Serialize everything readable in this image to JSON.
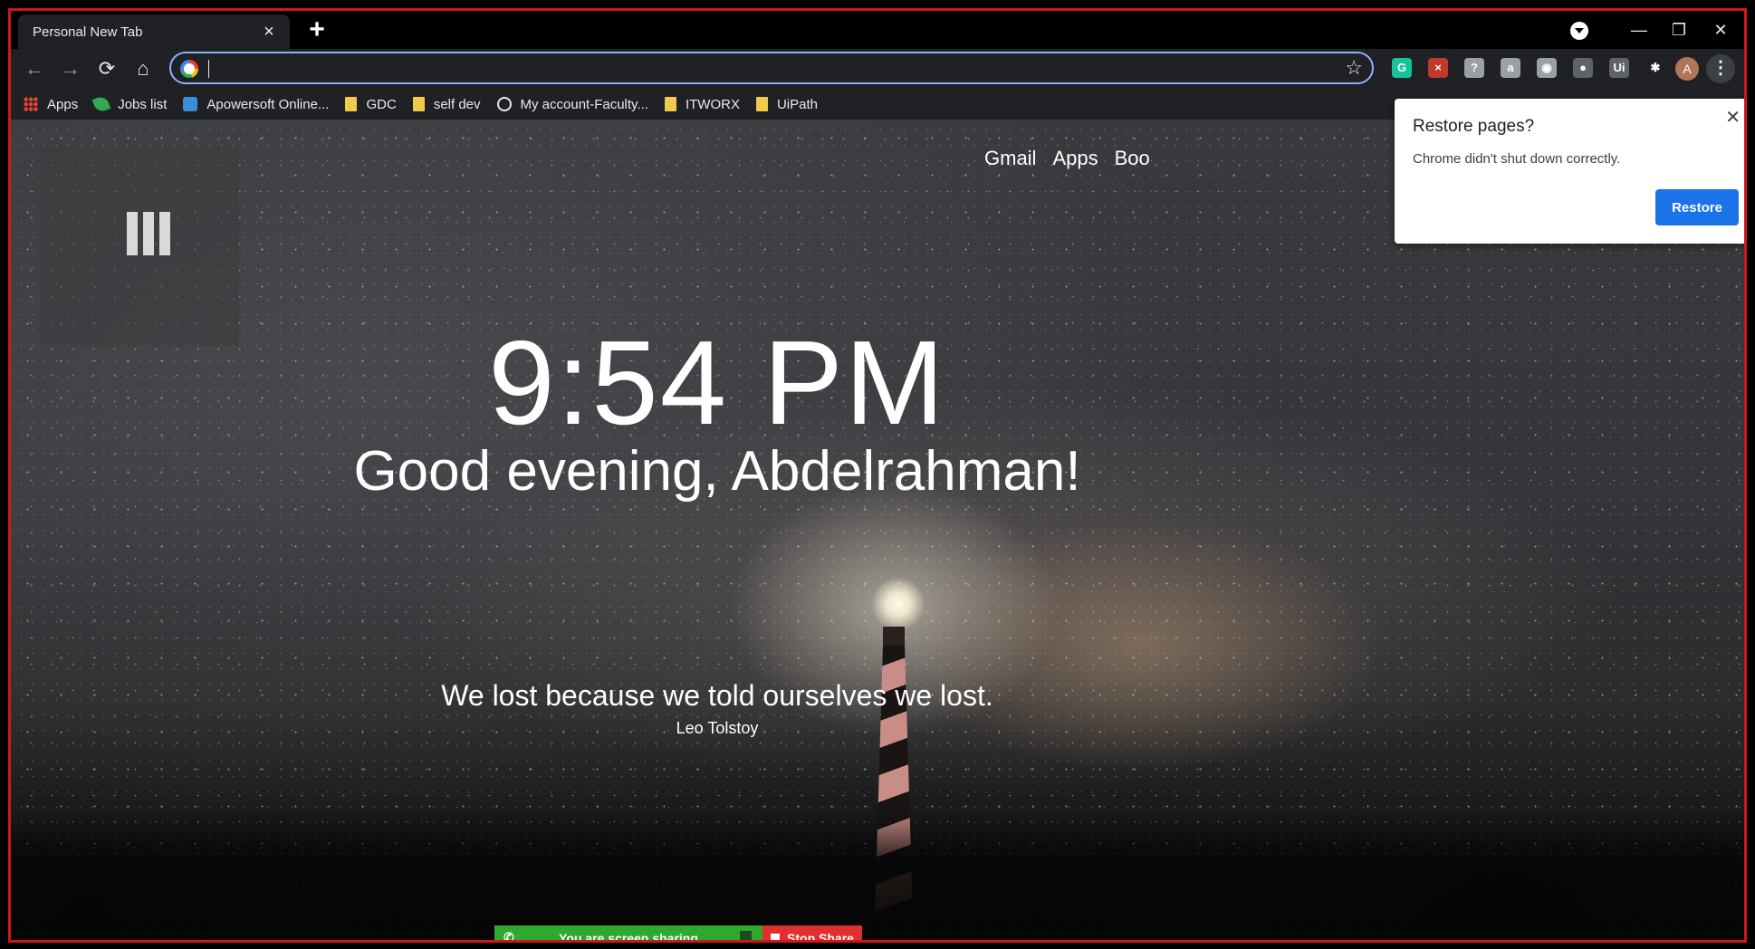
{
  "tab": {
    "title": "Personal New Tab",
    "close": "×",
    "new_tab": "+"
  },
  "window_controls": {
    "minimize": "—",
    "restore": "❐",
    "close": "✕"
  },
  "toolbar": {
    "back": "←",
    "forward": "→",
    "reload": "⟳",
    "home": "⌂",
    "address_value": "",
    "star": "☆",
    "avatar_letter": "A",
    "menu": "⋮",
    "extensions": [
      {
        "name": "grammarly-icon",
        "label": "G",
        "color": "#15c39a"
      },
      {
        "name": "adblock-icon",
        "label": "×",
        "color": "#c0392b"
      },
      {
        "name": "privacy-shield-icon",
        "label": "?",
        "color": "#9aa0a6"
      },
      {
        "name": "clipboard-icon",
        "label": "a",
        "color": "#9aa0a6"
      },
      {
        "name": "camera-icon",
        "label": "◉",
        "color": "#9aa0a6"
      },
      {
        "name": "circle-ext-icon",
        "label": "●",
        "color": "#5f6368"
      },
      {
        "name": "uipath-icon",
        "label": "Ui",
        "color": "#5f6368"
      },
      {
        "name": "puzzle-extensions-icon",
        "label": "✱",
        "color": "#202124"
      }
    ]
  },
  "bookmarks": [
    {
      "label": "Apps",
      "icon": "apps-grid-icon"
    },
    {
      "label": "Jobs list",
      "icon": "leaf-icon"
    },
    {
      "label": "Apowersoft Online...",
      "icon": "apowersoft-icon"
    },
    {
      "label": "GDC",
      "icon": "folder-icon"
    },
    {
      "label": "self dev",
      "icon": "folder-icon"
    },
    {
      "label": "My account-Faculty...",
      "icon": "globe-icon"
    },
    {
      "label": "ITWORX",
      "icon": "folder-icon"
    },
    {
      "label": "UiPath",
      "icon": "folder-icon"
    }
  ],
  "page": {
    "links": [
      "Gmail",
      "Apps",
      "Boo"
    ],
    "clock": "9:54 PM",
    "greeting": "Good evening, Abdelrahman!",
    "quote": "We lost because we told ourselves we lost.",
    "author": "Leo Tolstoy"
  },
  "popup": {
    "title": "Restore pages?",
    "body": "Chrome didn't shut down correctly.",
    "button": "Restore",
    "close": "✕"
  },
  "share": {
    "status": "You are screen sharing",
    "stop": "Stop Share",
    "green": "#2ea82e",
    "red": "#e02f2f"
  }
}
